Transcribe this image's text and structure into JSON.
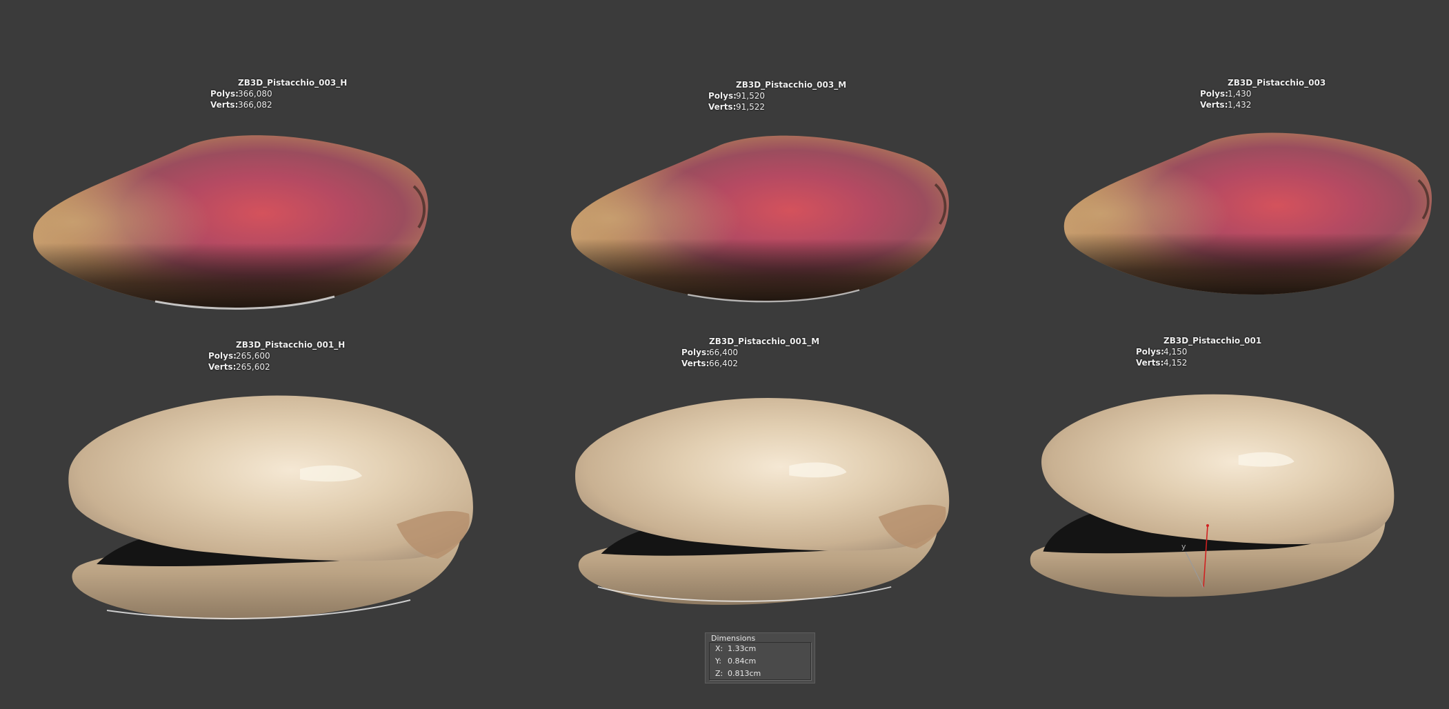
{
  "viewport": {
    "background": "#3b3b3b"
  },
  "models": [
    {
      "name": "ZB3D_Pistacchio_003_H",
      "polys_label": "Polys:",
      "polys": "366,080",
      "verts_label": "Verts:",
      "verts": "366,082",
      "kind": "kernel"
    },
    {
      "name": "ZB3D_Pistacchio_003_M",
      "polys_label": "Polys:",
      "polys": "91,520",
      "verts_label": "Verts:",
      "verts": "91,522",
      "kind": "kernel"
    },
    {
      "name": "ZB3D_Pistacchio_003",
      "polys_label": "Polys:",
      "polys": "1,430",
      "verts_label": "Verts:",
      "verts": "1,432",
      "kind": "kernel"
    },
    {
      "name": "ZB3D_Pistacchio_001_H",
      "polys_label": "Polys:",
      "polys": "265,600",
      "verts_label": "Verts:",
      "verts": "265,602",
      "kind": "shell"
    },
    {
      "name": "ZB3D_Pistacchio_001_M",
      "polys_label": "Polys:",
      "polys": "66,400",
      "verts_label": "Verts:",
      "verts": "66,402",
      "kind": "shell"
    },
    {
      "name": "ZB3D_Pistacchio_001",
      "polys_label": "Polys:",
      "polys": "4,150",
      "verts_label": "Verts:",
      "verts": "4,152",
      "kind": "shell"
    }
  ],
  "gizmo": {
    "axis_label": "y",
    "colors": {
      "z_axis": "#d02020",
      "y_axis": "#9a9a9a"
    }
  },
  "dimensions": {
    "title": "Dimensions",
    "rows": [
      {
        "axis": "X:",
        "value": "1.33cm"
      },
      {
        "axis": "Y:",
        "value": "0.84cm"
      },
      {
        "axis": "Z:",
        "value": "0.813cm"
      }
    ]
  },
  "colors": {
    "kernel_skin_light": "#c9a070",
    "kernel_skin_pink": "#b04a5c",
    "kernel_skin_red": "#d0505a",
    "kernel_dark": "#2a1a14",
    "shell_light": "#ecdcc2",
    "shell_mid": "#cdb596",
    "shell_dark": "#8f7a62",
    "shell_interior": "#141414"
  }
}
